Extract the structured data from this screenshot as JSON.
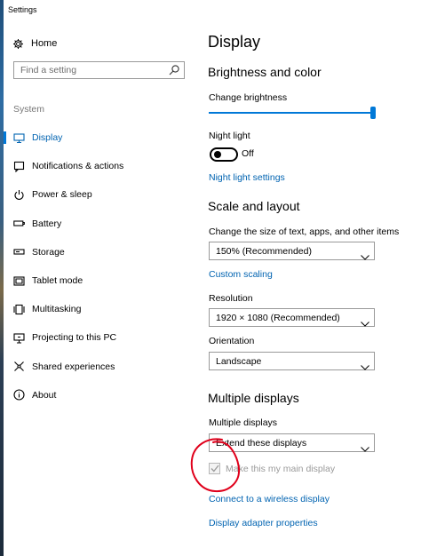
{
  "window": {
    "title": "Settings"
  },
  "sidebar": {
    "home_label": "Home",
    "search_placeholder": "Find a setting",
    "section_label": "System",
    "items": [
      {
        "label": "Display",
        "icon": "monitor-icon",
        "active": true
      },
      {
        "label": "Notifications & actions",
        "icon": "notifications-icon",
        "active": false
      },
      {
        "label": "Power & sleep",
        "icon": "power-icon",
        "active": false
      },
      {
        "label": "Battery",
        "icon": "battery-icon",
        "active": false
      },
      {
        "label": "Storage",
        "icon": "storage-icon",
        "active": false
      },
      {
        "label": "Tablet mode",
        "icon": "tablet-icon",
        "active": false
      },
      {
        "label": "Multitasking",
        "icon": "multitasking-icon",
        "active": false
      },
      {
        "label": "Projecting to this PC",
        "icon": "projecting-icon",
        "active": false
      },
      {
        "label": "Shared experiences",
        "icon": "shared-experiences-icon",
        "active": false
      },
      {
        "label": "About",
        "icon": "info-icon",
        "active": false
      }
    ]
  },
  "main": {
    "title": "Display",
    "brightness": {
      "heading": "Brightness and color",
      "change_brightness_label": "Change brightness",
      "brightness_level_percent": 100,
      "night_light_label": "Night light",
      "night_light_state": "Off",
      "night_light_settings_link": "Night light settings"
    },
    "scale": {
      "heading": "Scale and layout",
      "size_label": "Change the size of text, apps, and other items",
      "size_value": "150% (Recommended)",
      "custom_scaling_link": "Custom scaling",
      "resolution_label": "Resolution",
      "resolution_value": "1920 × 1080 (Recommended)",
      "orientation_label": "Orientation",
      "orientation_value": "Landscape"
    },
    "multiple": {
      "heading": "Multiple displays",
      "label": "Multiple displays",
      "value": "Extend these displays",
      "main_display_checkbox": "Make this my main display",
      "main_display_checked": true,
      "wireless_link": "Connect to a wireless display",
      "adapter_link": "Display adapter properties"
    }
  },
  "colors": {
    "accent": "#0078d7",
    "link": "#0063b1",
    "annotation": "#e0001b"
  }
}
